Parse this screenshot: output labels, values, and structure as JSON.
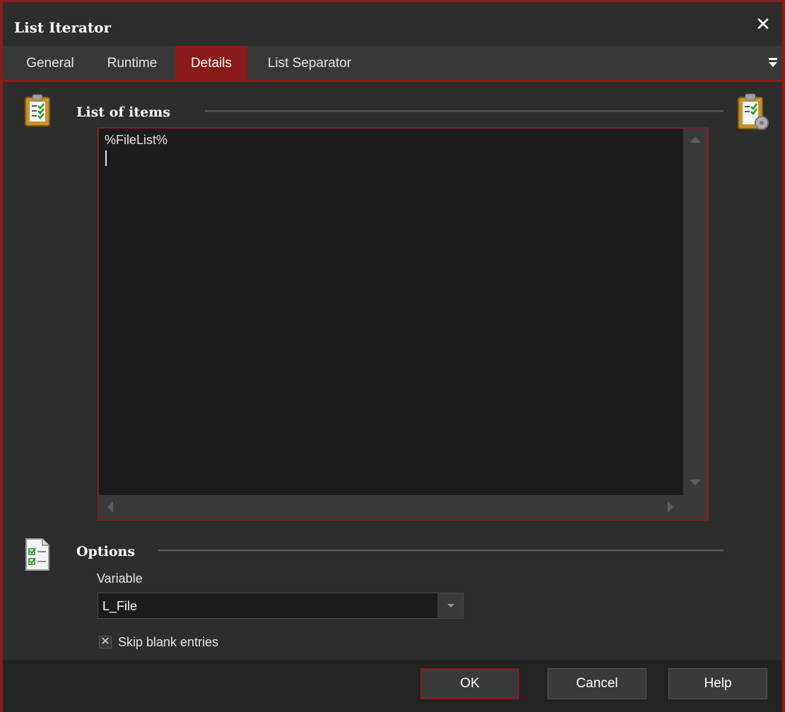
{
  "window": {
    "title": "List Iterator"
  },
  "tabs": [
    {
      "label": "General"
    },
    {
      "label": "Runtime"
    },
    {
      "label": "Details"
    },
    {
      "label": "List Separator"
    }
  ],
  "list_section": {
    "title": "List of items",
    "memo_text": "%FileList%"
  },
  "options_section": {
    "title": "Options",
    "variable_label": "Variable",
    "variable_value": "L_File",
    "skip_blank_label": "Skip blank entries",
    "skip_blank_checked": true
  },
  "buttons": {
    "ok": "OK",
    "cancel": "Cancel",
    "help": "Help"
  },
  "colors": {
    "accent": "#8b1a1a",
    "background": "#2d2d2d",
    "editor_bg": "#1c1c1c"
  }
}
